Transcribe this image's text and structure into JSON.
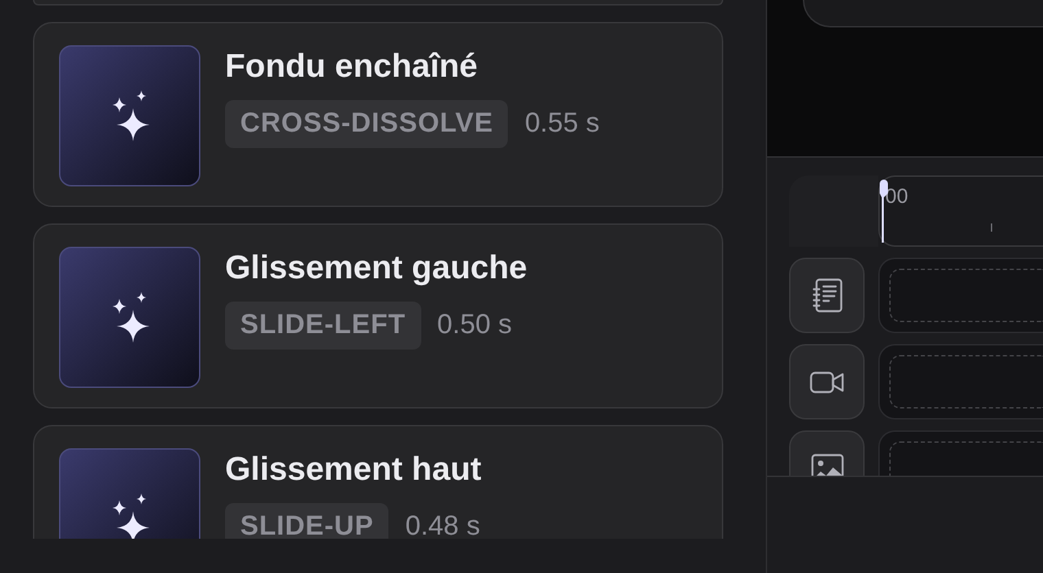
{
  "transitions": [
    {
      "name": "Fondu enchaîné",
      "code": "CROSS-DISSOLVE",
      "duration": "0.55 s"
    },
    {
      "name": "Glissement gauche",
      "code": "SLIDE-LEFT",
      "duration": "0.50 s"
    },
    {
      "name": "Glissement haut",
      "code": "SLIDE-UP",
      "duration": "0.48 s"
    }
  ],
  "timeline": {
    "ruler_label": "00",
    "tracks": [
      {
        "kind": "text"
      },
      {
        "kind": "video"
      },
      {
        "kind": "image"
      }
    ]
  }
}
